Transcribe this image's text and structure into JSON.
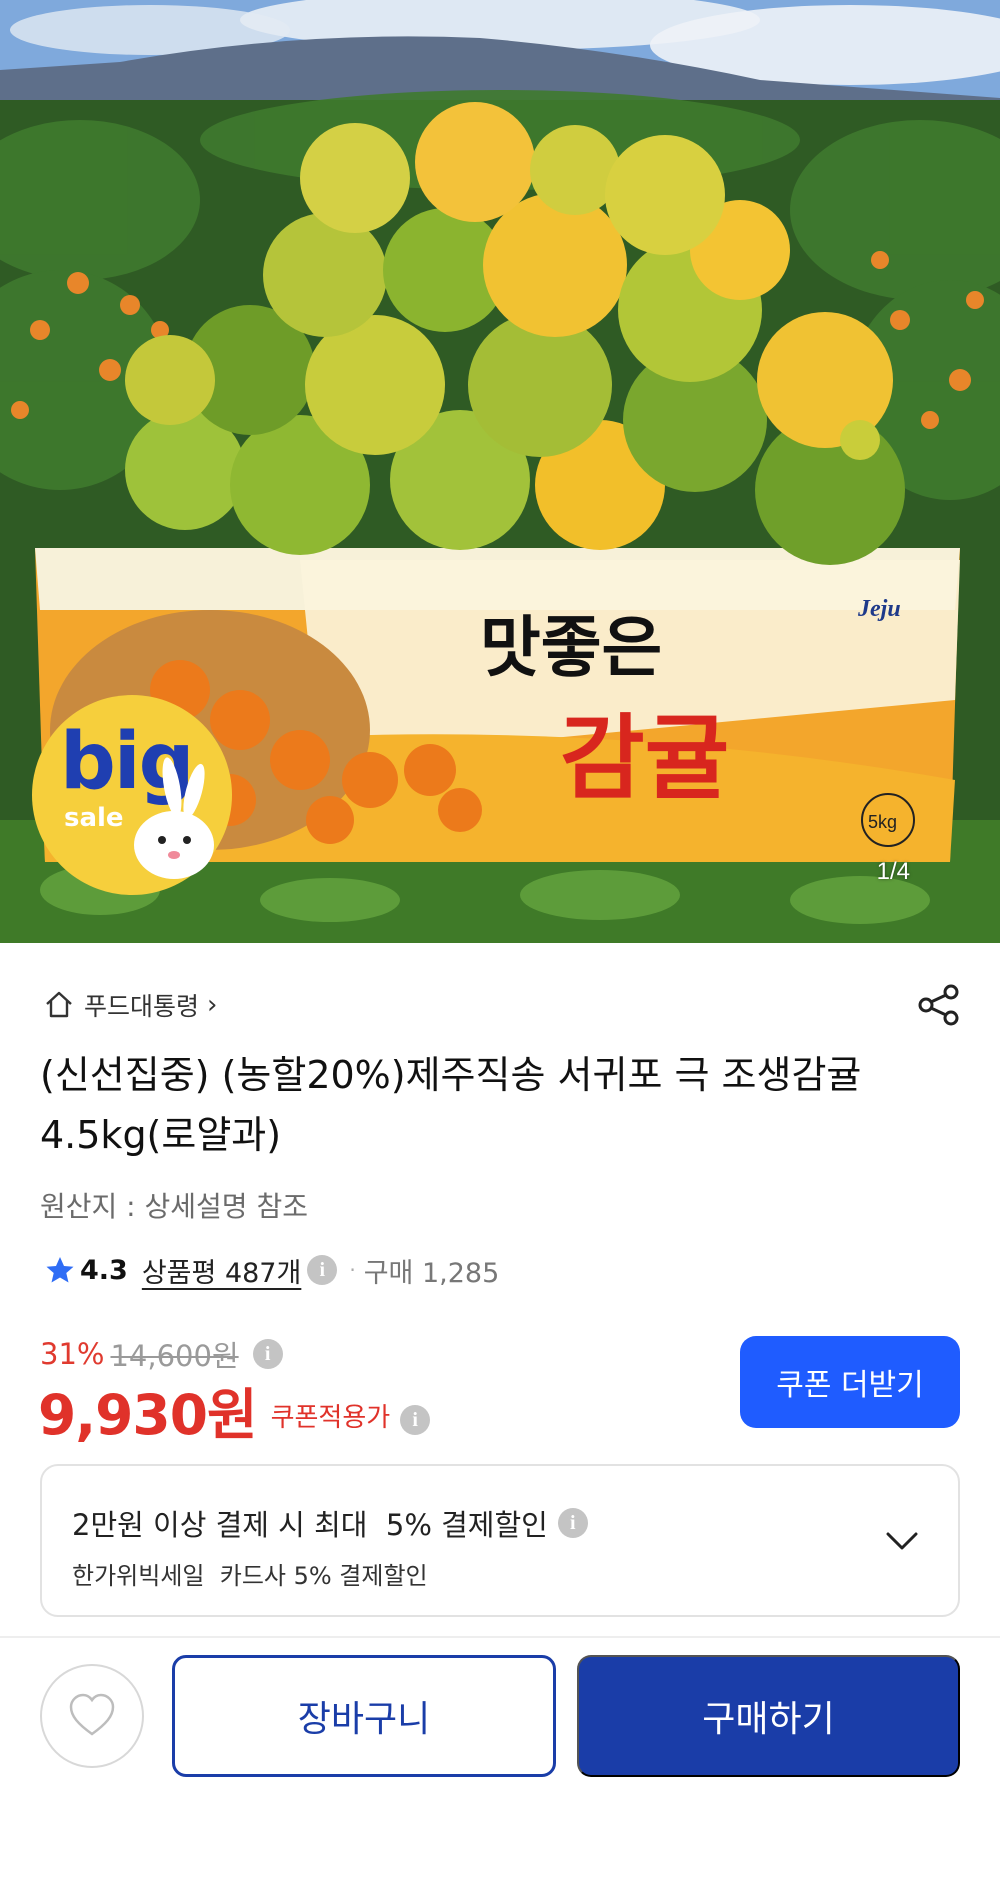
{
  "hero": {
    "image_counter": "1/4",
    "badge": {
      "big": "big",
      "sale": "sale"
    },
    "box_text": {
      "line1": "맛좋은",
      "line2": "감귤",
      "brand": "Jeju",
      "weight": "5kg"
    }
  },
  "store": {
    "name": "푸드대통령",
    "chevron": "›"
  },
  "product": {
    "title": "(신선집중) (농할20%)제주직송 서귀포 극 조생감귤 4.5kg(로얄과)",
    "origin": "원산지 : 상세설명 참조"
  },
  "rating": {
    "score": "4.3",
    "reviews_label": "상품평 487개",
    "separator": "·",
    "purchases": "구매 1,285"
  },
  "price": {
    "discount": "31%",
    "original": "14,600원",
    "final": "9,930원",
    "coupon_label": "쿠폰적용가",
    "coupon_button": "쿠폰 더받기"
  },
  "payment_benefit": {
    "line1": "2만원 이상 결제 시 최대  5% 결제할인",
    "line2": "한가위빅세일  카드사 5% 결제할인"
  },
  "bottom_bar": {
    "cart": "장바구니",
    "buy": "구매하기"
  },
  "colors": {
    "accent_blue": "#1f5cff",
    "primary_navy": "#1a3da8",
    "price_red": "#e0322a",
    "badge_yellow": "#f6cf3c"
  },
  "icons": [
    "home-icon",
    "share-icon",
    "star-icon",
    "info-icon",
    "chevron-down-icon",
    "heart-icon"
  ]
}
